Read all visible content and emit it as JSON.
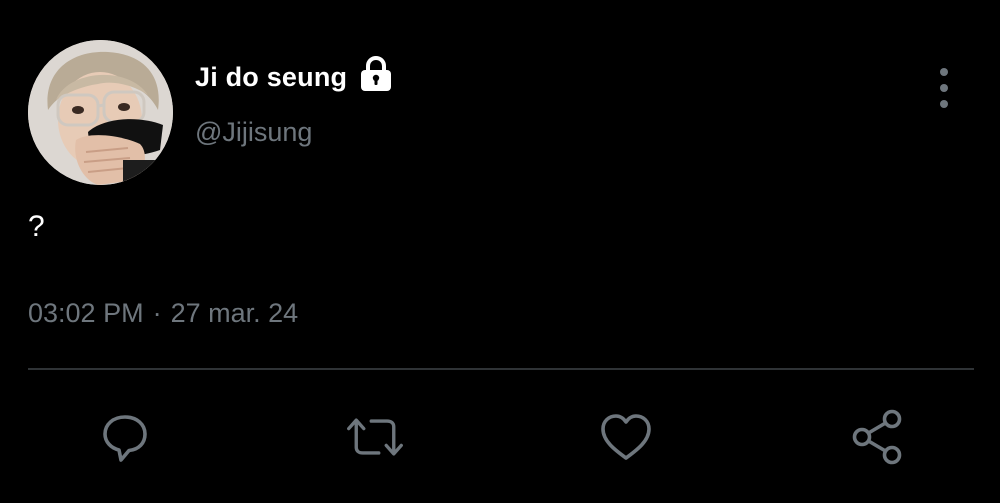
{
  "tweet": {
    "display_name": "Ji do seung",
    "handle": "@Jijisung",
    "text": "?",
    "time": "03:02 PM",
    "separator": "·",
    "date": "27 mar. 24"
  },
  "icons": {
    "lock": "lock-icon",
    "more": "vertical-dots-icon",
    "reply": "speech-bubble-icon",
    "retweet": "retweet-arrows-icon",
    "like": "heart-icon",
    "share": "share-nodes-icon"
  },
  "colors": {
    "background": "#000000",
    "primary_text": "#ffffff",
    "secondary_text": "#6e767d",
    "divider": "#2f3336"
  }
}
